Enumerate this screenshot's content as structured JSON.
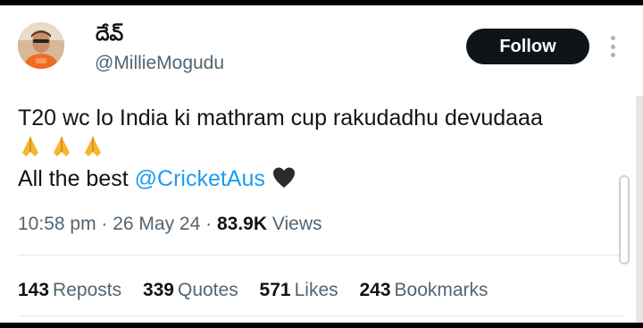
{
  "author": {
    "display_name": "దేవ్",
    "handle": "@MillieMogudu",
    "avatar": "avatar-photo"
  },
  "actions": {
    "follow_label": "Follow",
    "more_icon": "more-dots-icon"
  },
  "tweet": {
    "line1": "T20 wc lo India ki mathram cup rakudadhu devudaaa",
    "emojis_line2": "folded-hands-emoji x3",
    "line3_prefix": "All the best ",
    "mention": "@CricketAus",
    "trailing_emoji": "black-heart-emoji"
  },
  "meta": {
    "time": "10:58 pm",
    "sep1": " · ",
    "date": "26 May 24",
    "sep2": " · ",
    "views_count": "83.9K",
    "views_label": " Views"
  },
  "stats": {
    "reposts_count": "143",
    "reposts_label": "Reposts",
    "quotes_count": "339",
    "quotes_label": "Quotes",
    "likes_count": "571",
    "likes_label": "Likes",
    "bookmarks_count": "243",
    "bookmarks_label": "Bookmarks"
  },
  "colors": {
    "link": "#1d9bf0",
    "text": "#0f1419",
    "muted": "#536471",
    "button": "#0f1419"
  }
}
